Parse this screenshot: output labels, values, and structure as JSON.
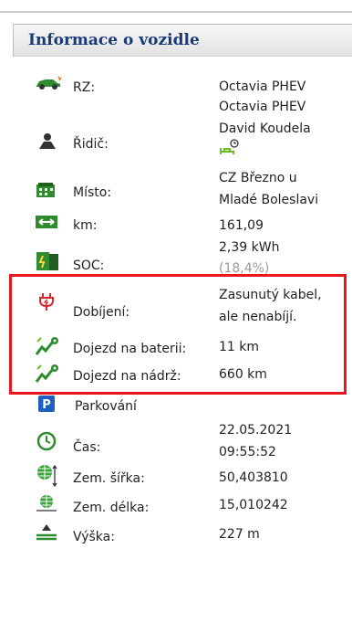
{
  "panel": {
    "title": "Informace o vozidle"
  },
  "rows": {
    "rz": {
      "label": "RZ:",
      "value_lines": [
        "Octavia PHEV"
      ]
    },
    "ridic": {
      "label": "Řidič:",
      "value_lines": [
        "Octavia PHEV",
        "David Koudela"
      ]
    },
    "misto": {
      "label": "Místo:",
      "value_lines": [
        "CZ Březno u",
        "Mladé Boleslavi"
      ]
    },
    "km": {
      "label": "km:",
      "value": "161,09"
    },
    "soc": {
      "label": "SOC:",
      "value_lines": [
        "2,39 kWh",
        "(18,4%)"
      ]
    },
    "dobijeni": {
      "label": "Dobíjení:",
      "value_lines": [
        "Zasunutý kabel,",
        "ale nenabíjí."
      ]
    },
    "dojezd_baterie": {
      "label": "Dojezd na baterii:",
      "value": "11 km"
    },
    "dojezd_nadrz": {
      "label": "Dojezd na nádrž:",
      "value": "660 km"
    },
    "parkovani": {
      "label": "Parkování"
    },
    "cas": {
      "label": "Čas:",
      "value_lines": [
        "22.05.2021",
        "09:55:52"
      ]
    },
    "sirka": {
      "label": "Zem. šířka:",
      "value": "50,403810"
    },
    "delka": {
      "label": "Zem. délka:",
      "value": "15,010242"
    },
    "vyska": {
      "label": "Výška:",
      "value": "227 m"
    }
  },
  "icons": {
    "rz": "car-icon",
    "ridic": "driver-icon",
    "driver_status": "driver-status-icon",
    "misto": "location-building-icon",
    "km": "distance-arrows-icon",
    "soc": "battery-fuel-icon",
    "dobijeni": "charging-plug-icon",
    "dojezd_baterie": "range-battery-icon",
    "dojezd_nadrz": "range-tank-icon",
    "parkovani": "parking-icon",
    "cas": "clock-icon",
    "sirka": "latitude-globe-icon",
    "delka": "longitude-globe-icon",
    "vyska": "altitude-icon"
  },
  "colors": {
    "title": "#1a3a7a",
    "highlight_border": "#e8191e",
    "icon_green": "#2e8b2e",
    "charging_red": "#d9252b",
    "parking_blue": "#1f5fbf"
  }
}
